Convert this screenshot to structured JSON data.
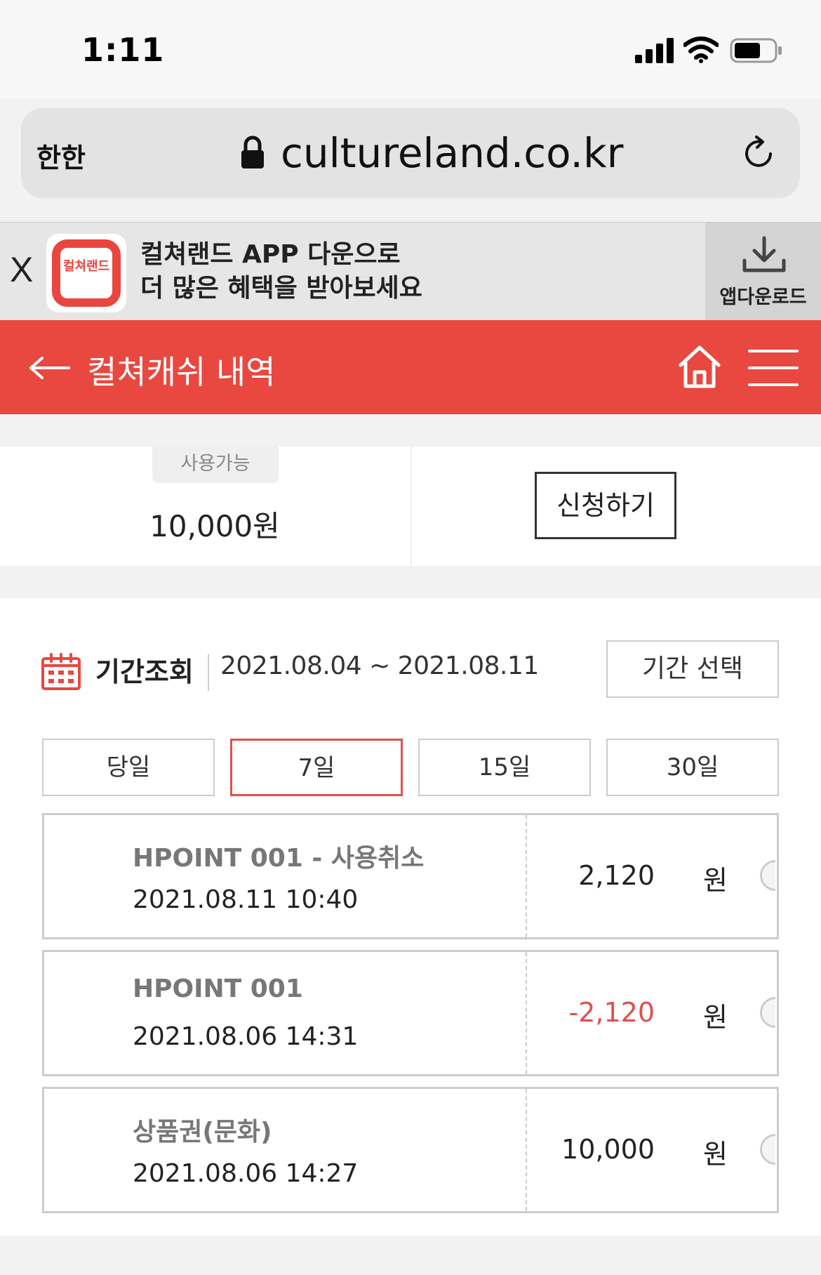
{
  "status_bar": {
    "time": "1:11"
  },
  "browser": {
    "text_size_label": "한한",
    "url": "cultureland.co.kr"
  },
  "app_banner": {
    "close_label": "X",
    "logo_text": "컬쳐랜드",
    "line1": "컬쳐랜드 APP 다운으로",
    "line2": "더 많은 혜택을 받아보세요",
    "download_label": "앱다운로드"
  },
  "header": {
    "title": "컬쳐캐쉬 내역"
  },
  "balance": {
    "tag": "사용가능",
    "amount": "10,000원",
    "apply_button": "신청하기"
  },
  "period": {
    "label": "기간조회",
    "range": "2021.08.04 ~ 2021.08.11",
    "select_button": "기간 선택",
    "tabs": [
      "당일",
      "7일",
      "15일",
      "30일"
    ],
    "active_tab": "7일"
  },
  "colors": {
    "accent": "#e8483f",
    "negative": "#e0504a"
  },
  "transactions": [
    {
      "name": "HPOINT 001 - 사용취소",
      "datetime": "2021.08.11 10:40",
      "amount": "2,120",
      "unit": "원"
    },
    {
      "name": "HPOINT 001",
      "datetime": "2021.08.06 14:31",
      "amount": "-2,120",
      "unit": "원"
    },
    {
      "name": "상품권(문화)",
      "datetime": "2021.08.06 14:27",
      "amount": "10,000",
      "unit": "원"
    }
  ]
}
